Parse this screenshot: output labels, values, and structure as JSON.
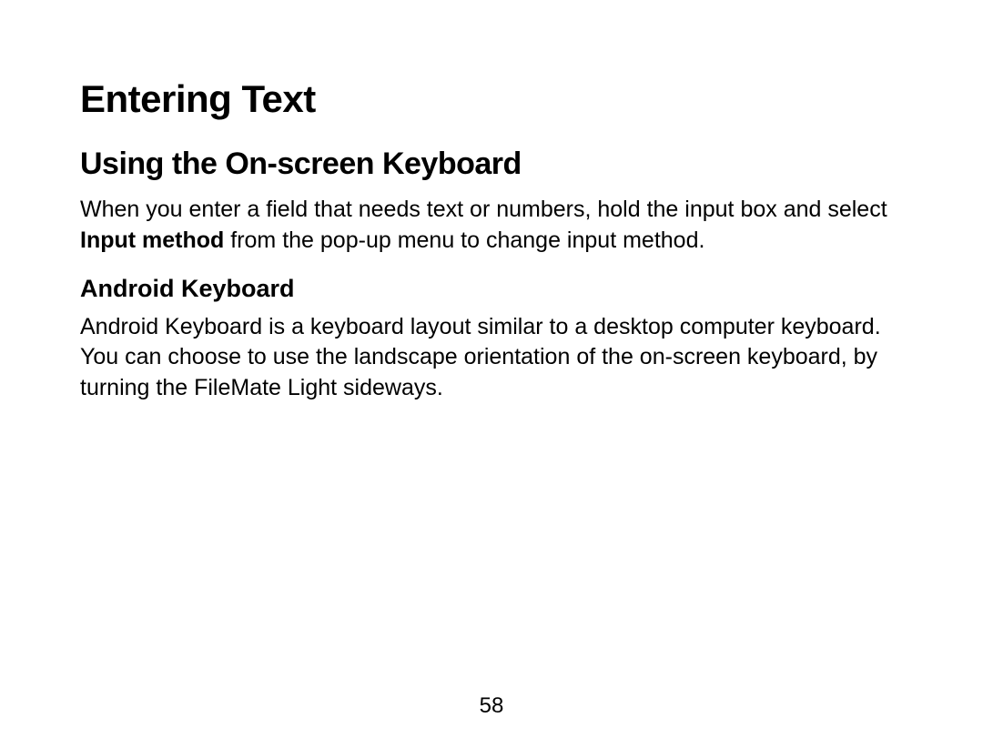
{
  "page": {
    "title": "Entering Text",
    "section1": {
      "heading": "Using the On-screen Keyboard",
      "para_pre": "When you enter a field that needs text or numbers, hold the input box and select ",
      "para_bold": "Input method",
      "para_post": " from the pop-up menu to change input method."
    },
    "section2": {
      "heading": "Android Keyboard",
      "para": "Android Keyboard is a keyboard layout similar to a desktop computer keyboard. You can choose to use the landscape orientation of the on-screen keyboard, by turning the FileMate Light sideways."
    },
    "page_number": "58"
  }
}
